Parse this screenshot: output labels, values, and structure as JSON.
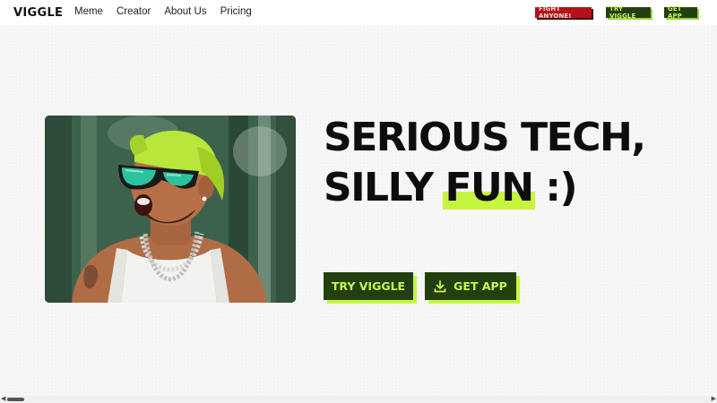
{
  "header": {
    "logo": "VIGGLE",
    "nav": [
      {
        "label": "Meme"
      },
      {
        "label": "Creator"
      },
      {
        "label": "About Us"
      },
      {
        "label": "Pricing"
      }
    ],
    "buttons": {
      "fight": "FIGHT ANYONE!",
      "try": "TRY VIGGLE",
      "get": "GET APP"
    }
  },
  "hero": {
    "headline_line1": "SERIOUS TECH,",
    "headline_line2_prefix": "SILLY ",
    "headline_highlight": "FUN",
    "headline_line2_suffix": " :)",
    "cta_try": "TRY VIGGLE",
    "cta_get": "GET APP",
    "download_icon": "download-icon"
  },
  "colors": {
    "brand_dark_green": "#22400f",
    "brand_lime": "#c6f53f",
    "fight_red": "#b3121b",
    "text_dark": "#0d0d0d"
  }
}
